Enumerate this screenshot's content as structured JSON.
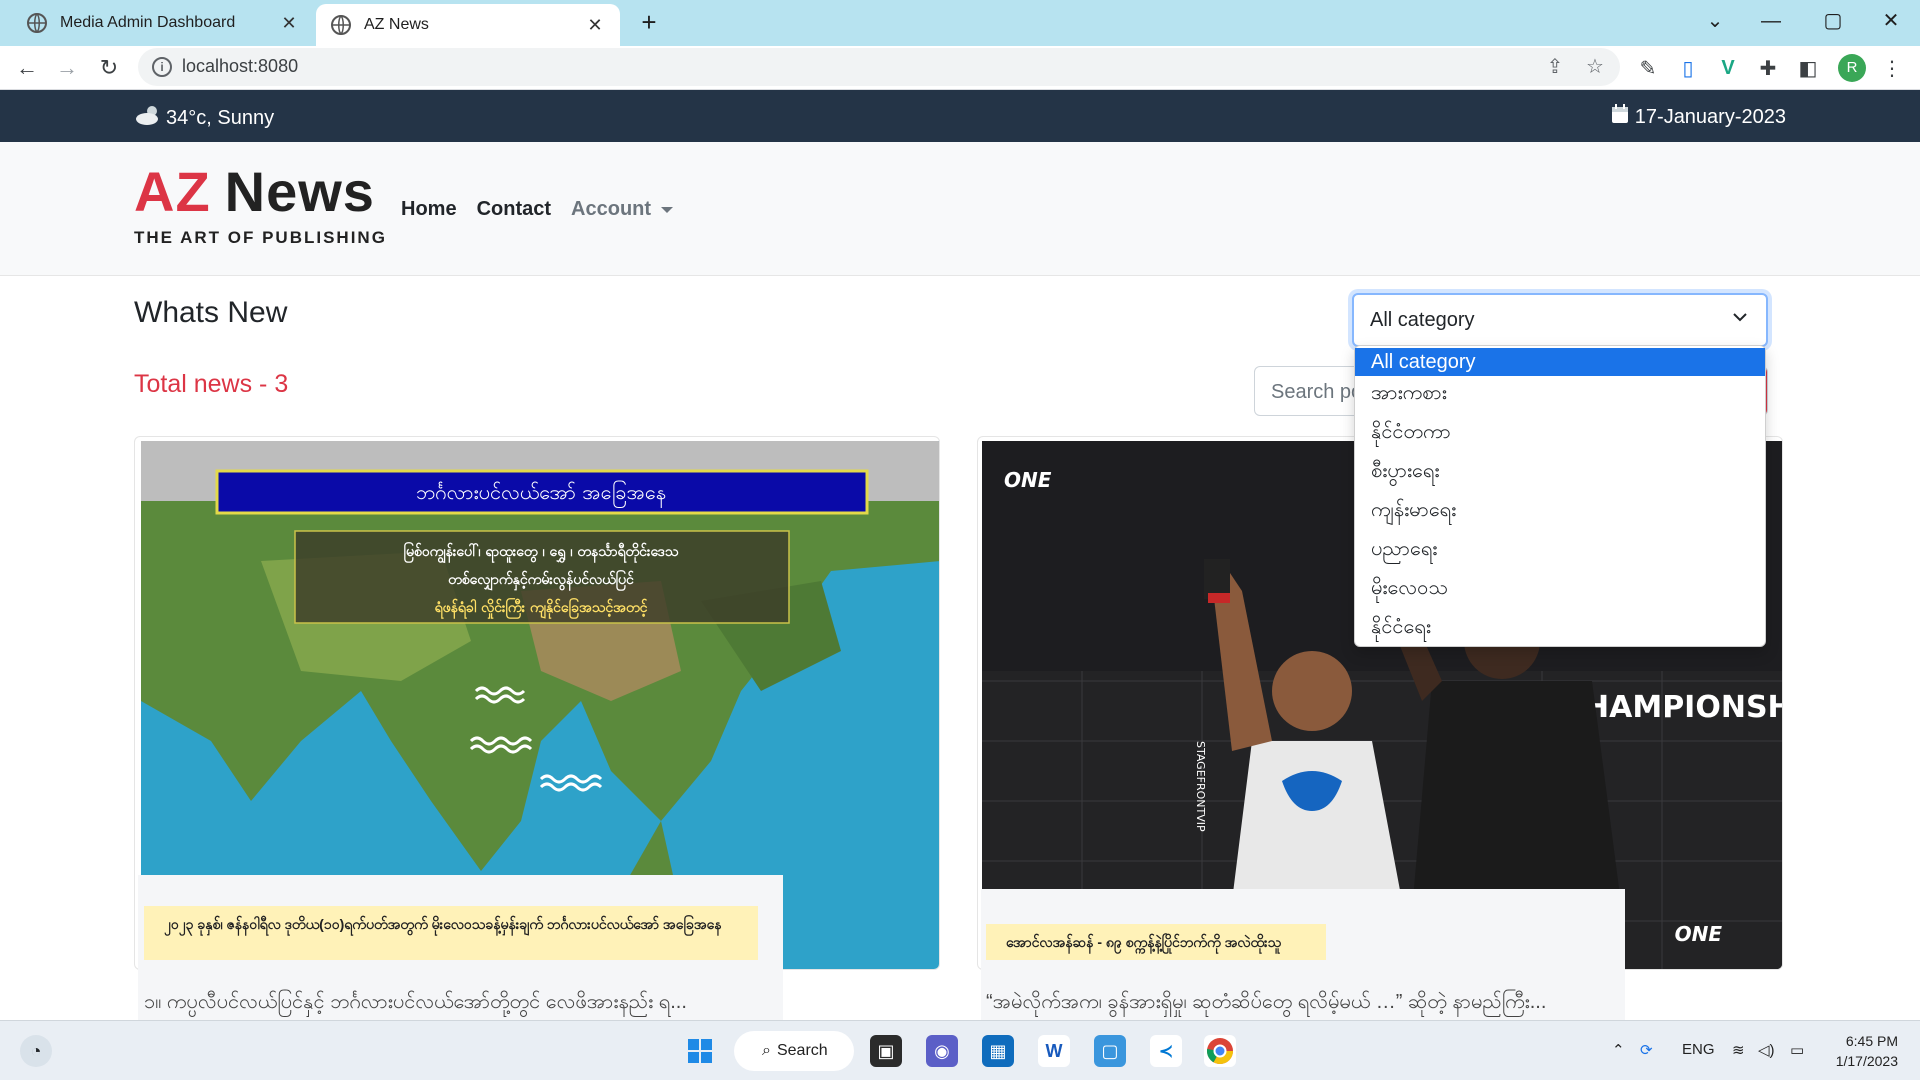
{
  "browser": {
    "tabs": [
      {
        "title": "Media Admin Dashboard",
        "active": false
      },
      {
        "title": "AZ News",
        "active": true
      }
    ],
    "url": "localhost:8080",
    "profile_initial": "R"
  },
  "site": {
    "weather": "34°c, Sunny",
    "date": "17-January-2023",
    "logo": {
      "az": "AZ",
      "news": "News",
      "tagline": "THE ART OF PUBLISHING"
    },
    "nav": {
      "home": "Home",
      "contact": "Contact",
      "account": "Account"
    },
    "page_title": "Whats New",
    "total_news": "Total news - 3",
    "category_select": {
      "value": "All category",
      "options": [
        "All category",
        "အားကစား",
        "နိုင်ငံတကာ",
        "စီးပွားရေး",
        "ကျန်းမာရေး",
        "ပညာရေး",
        "မိုးလေဝသ",
        "နိုင်ငံရေး"
      ]
    },
    "search": {
      "placeholder": "Search po"
    },
    "cards": [
      {
        "image_title": "ဘင်္ဂလားပင်လယ်အော် အခြေအနေ",
        "image_text": [
          "မြစ်ဝကျွန်းပေါ်၊ ရာထူးတွေ ၊ ရွှေ ၊ တနင်္သာရီတိုင်းဒေသ",
          "တစ်လျှောက်နှင့်ကမ်းလွန်ပင်လယ်ပြင်",
          "ရံဖန်ရံခါ လှိုင်းကြီး ကျနိုင်ခြေအသင့်အတင့်"
        ],
        "category": "၂၀၂၃ ခုနှစ်၊ ဇန်နဝါရီလ ဒုတိယ(၁၀)ရက်ပတ်အတွက် မိုးလေဝသခန့်မှန်းချက် ဘင်္ဂလားပင်လယ်အော် အခြေအနေ",
        "excerpt": "၁။ ကပ္ပလီပင်လယ်ပြင်နှင့် ဘင်္ဂလားပင်လယ်အော်တို့တွင် လေဖိအားနည်း ရ..."
      },
      {
        "image_brand": "ONE",
        "image_banner": "CHAMPIONSHIP",
        "image_side_text": "STAGEFRONTVIP",
        "category": "အောင်လအန်ဆန် - ၈၉ စက္ကန့်နဲ့ပြိုင်ဘက်ကို အလဲထိုးသူ",
        "excerpt": "“အမဲလိုက်အက၊ ခွန်အားရှိမှု၊ ဆုတံဆိပ်တွေ ရလိမ့်မယ် …” ဆိုတဲ့ နာမည်ကြီး..."
      }
    ]
  },
  "taskbar": {
    "search_label": "Search",
    "language": "ENG",
    "time": "6:45 PM",
    "date": "1/17/2023"
  },
  "colors": {
    "brand_red": "#dc3545",
    "topbar_bg": "#243447",
    "tab_strip": "#b7e3f0",
    "select_highlight": "#1a73e8"
  }
}
